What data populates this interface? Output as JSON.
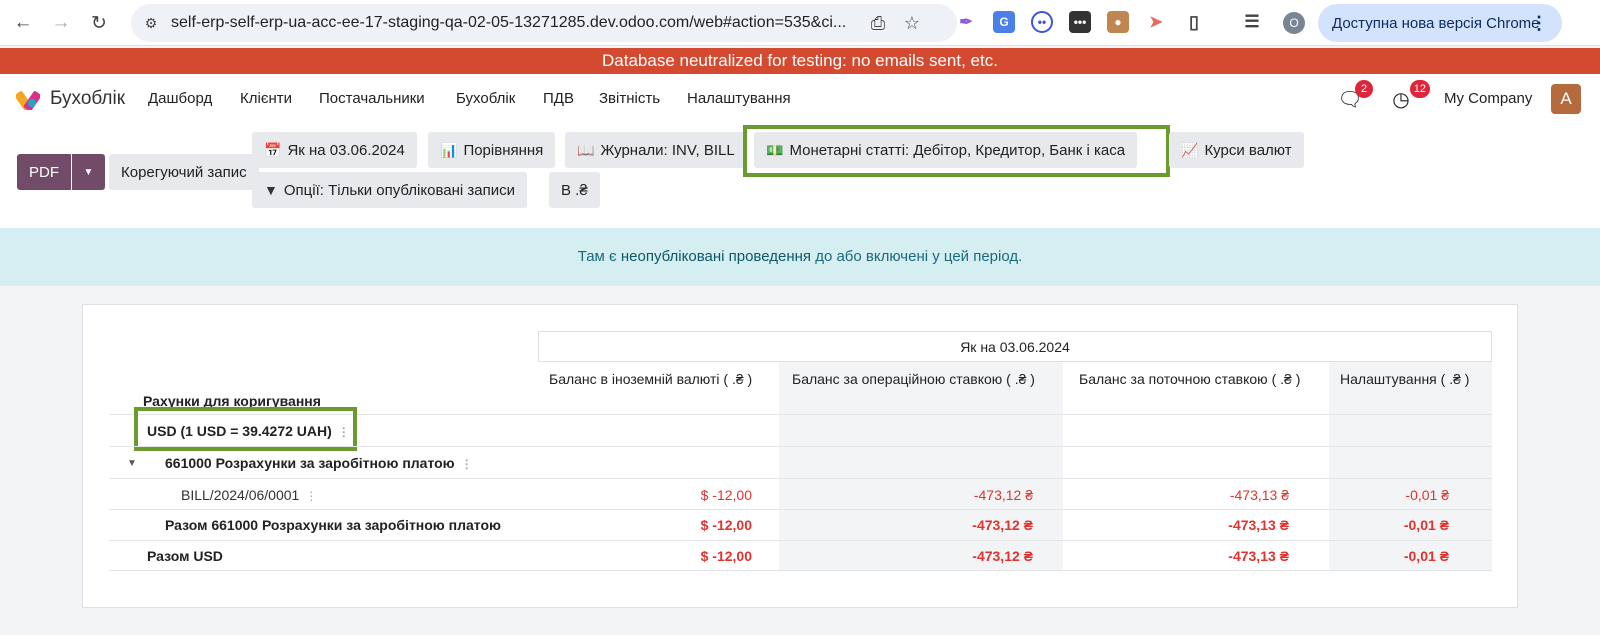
{
  "browser": {
    "url": "self-erp-self-erp-ua-acc-ee-17-staging-qa-02-05-13271285.dev.odoo.com/web#action=535&ci...",
    "profile_initial": "O",
    "update_label": "Доступна нова версія Chrome"
  },
  "banner": "Database neutralized for testing: no emails sent, etc.",
  "app": {
    "name": "Бухоблік",
    "menu": [
      "Дашборд",
      "Клієнти",
      "Постачальники",
      "Бухоблік",
      "ПДВ",
      "Звітність",
      "Налаштування"
    ],
    "messages_count": "2",
    "activities_count": "12",
    "company": "My Company",
    "avatar_initial": "A"
  },
  "controls": {
    "pdf_label": "PDF",
    "adjust_label": "Корегуючий запис",
    "filters": {
      "date": "Як на 03.06.2024",
      "comparison": "Порівняння",
      "journals": "Журнали: INV, BILL",
      "monetary": "Монетарні статті: Дебітор, Кредитор, Банк і каса",
      "rates": "Курси валют",
      "options": "Опції: Тільки опубліковані записи",
      "currency": "В .₴"
    }
  },
  "alert": {
    "prefix": "Там є",
    "link": "неопубліковані проведення",
    "suffix": "до або включені у цей період."
  },
  "report": {
    "period": "Як на 03.06.2024",
    "columns": [
      "Баланс в іноземній валюті ( .₴ )",
      "Баланс за операційною ставкою ( .₴ )",
      "Баланс за поточною ставкою ( .₴ )",
      "Налаштування ( .₴ )"
    ],
    "section_title": "Рахунки для коригування",
    "currency_group": "USD (1 USD = 39.4272 UAH)",
    "account": "661000 Розрахунки за заробітною платою",
    "line": {
      "name": "BILL/2024/06/0001",
      "values": [
        "$ -12,00",
        "-473,12 ₴",
        "-473,13 ₴",
        "-0,01 ₴"
      ]
    },
    "account_total": {
      "name": "Разом 661000 Розрахунки за заробітною платою",
      "values": [
        "$ -12,00",
        "-473,12 ₴",
        "-473,13 ₴",
        "-0,01 ₴"
      ]
    },
    "currency_total": {
      "name": "Разом USD",
      "values": [
        "$ -12,00",
        "-473,12 ₴",
        "-473,13 ₴",
        "-0,01 ₴"
      ]
    }
  },
  "colors": {
    "brand": "#714b67",
    "banner": "#d44a30",
    "alert_bg": "#d4eef2",
    "negative": "#e0332f",
    "highlight": "#6b9a2f"
  }
}
